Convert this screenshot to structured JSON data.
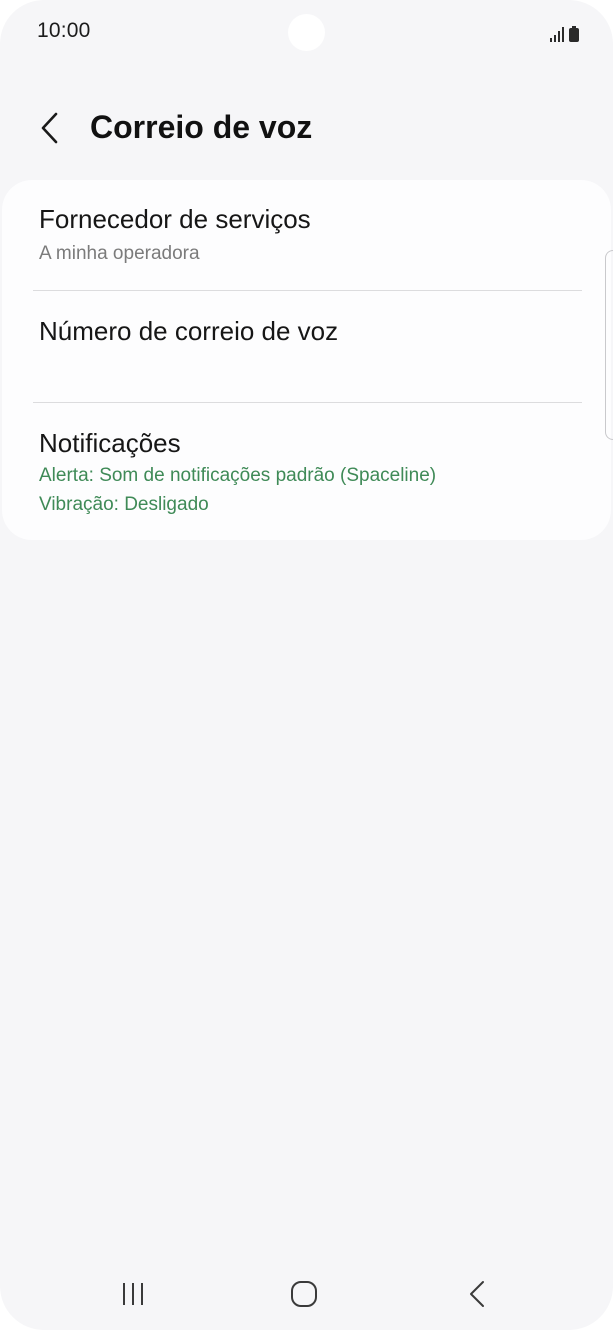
{
  "status_bar": {
    "time": "10:00",
    "icons": [
      "signal-icon",
      "battery-icon"
    ]
  },
  "header": {
    "title": "Correio de voz",
    "back_icon": "chevron-left-icon"
  },
  "settings": {
    "items": [
      {
        "title": "Fornecedor de serviços",
        "subtitle": "A minha operadora"
      },
      {
        "title": "Número de correio de voz"
      },
      {
        "title": "Notificações",
        "subtitle_line1": "Alerta: Som de notificações padrão (Spaceline)",
        "subtitle_line2": "Vibração: Desligado"
      }
    ]
  },
  "colors": {
    "background": "#f6f6f8",
    "card": "#fdfdfe",
    "accent_green": "#3f8a57",
    "secondary_text": "#7b7b7b"
  },
  "nav_bar": {
    "buttons": [
      "recent-apps-icon",
      "home-icon",
      "back-icon"
    ]
  }
}
